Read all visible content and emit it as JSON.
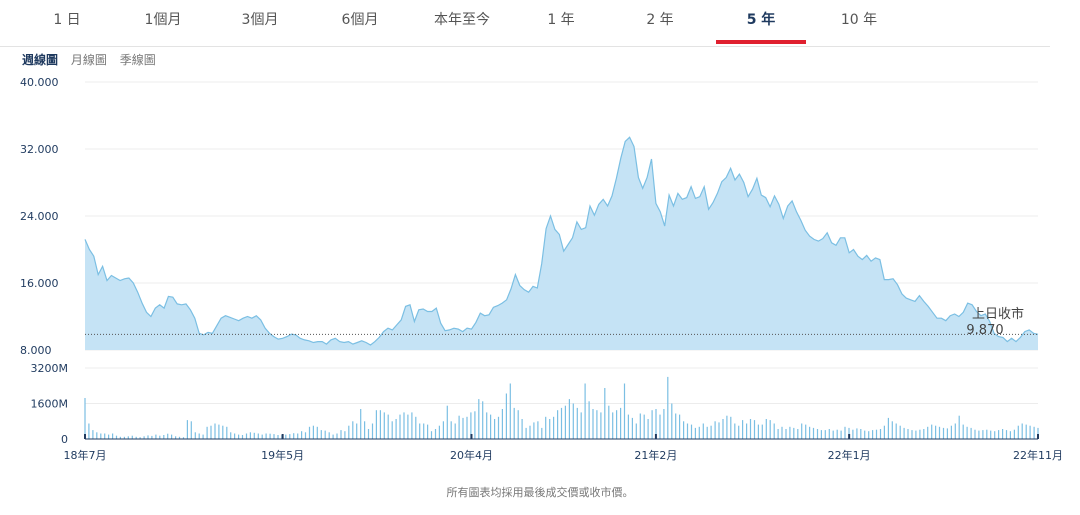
{
  "tabs": [
    {
      "label": "1 日",
      "active": false
    },
    {
      "label": "1個月",
      "active": false
    },
    {
      "label": "3個月",
      "active": false
    },
    {
      "label": "6個月",
      "active": false
    },
    {
      "label": "本年至今",
      "active": false
    },
    {
      "label": "1 年",
      "active": false
    },
    {
      "label": "2 年",
      "active": false
    },
    {
      "label": "5 年",
      "active": true
    },
    {
      "label": "10 年",
      "active": false
    }
  ],
  "views": [
    {
      "label": "週線圖",
      "active": true
    },
    {
      "label": "月線圖",
      "active": false
    },
    {
      "label": "季線圖",
      "active": false
    }
  ],
  "footnote": "所有圖表均採用最後成交價或收市價。",
  "colors": {
    "accent_underline": "#e0202f",
    "area_fill": "#c5e3f5",
    "line": "#7bbfe3",
    "volume_bar": "#7bbfe3",
    "axis_text": "#1f3a5f"
  },
  "chart_data": [
    {
      "type": "area",
      "y_ticks": [
        "40.000",
        "32.000",
        "24.000",
        "16.000",
        "8.000"
      ],
      "ylim": [
        8,
        40
      ],
      "last_close_label": "上日收市",
      "last_close_value": "9.870",
      "last_close": 9.87,
      "grid": true,
      "x_tick_labels": [
        "18年7月",
        "19年5月",
        "20年4月",
        "21年2月",
        "22年1月",
        "22年11月"
      ],
      "x_tick_index": [
        0,
        45,
        88,
        130,
        174,
        217
      ],
      "values": [
        21.2,
        20.0,
        19.2,
        17.0,
        18.0,
        16.3,
        16.9,
        16.6,
        16.3,
        16.5,
        16.6,
        16.0,
        14.9,
        13.6,
        12.5,
        12.0,
        13.0,
        13.4,
        13.0,
        14.4,
        14.3,
        13.5,
        13.4,
        13.5,
        12.8,
        11.8,
        10.0,
        9.8,
        10.1,
        10.0,
        10.9,
        11.8,
        12.1,
        11.9,
        11.7,
        11.5,
        11.8,
        12.0,
        11.8,
        12.1,
        11.6,
        10.6,
        10.0,
        9.6,
        9.3,
        9.4,
        9.6,
        9.9,
        9.8,
        9.4,
        9.2,
        9.1,
        8.9,
        9.0,
        9.0,
        8.7,
        9.2,
        9.4,
        9.0,
        8.9,
        9.0,
        8.7,
        8.9,
        9.1,
        8.9,
        8.6,
        9.0,
        9.5,
        10.2,
        10.6,
        10.4,
        11.0,
        11.6,
        13.2,
        13.4,
        11.4,
        12.8,
        12.9,
        12.6,
        12.6,
        13.0,
        11.2,
        10.3,
        10.4,
        10.6,
        10.5,
        10.2,
        10.6,
        10.5,
        11.3,
        12.4,
        12.1,
        12.2,
        13.1,
        13.3,
        13.6,
        14.0,
        15.3,
        17.0,
        15.7,
        15.2,
        14.9,
        15.6,
        15.4,
        18.3,
        22.5,
        24.0,
        22.4,
        21.8,
        19.8,
        20.6,
        21.4,
        23.3,
        22.4,
        22.6,
        25.2,
        24.1,
        25.4,
        26.0,
        25.2,
        26.4,
        28.5,
        30.9,
        32.9,
        33.4,
        32.3,
        28.6,
        27.3,
        28.6,
        30.8,
        25.5,
        24.5,
        22.8,
        26.5,
        25.2,
        26.7,
        26.0,
        26.2,
        27.5,
        26.1,
        26.3,
        27.5,
        24.8,
        25.6,
        26.7,
        28.1,
        28.6,
        29.7,
        28.3,
        29.0,
        28.0,
        26.3,
        27.2,
        28.5,
        26.5,
        26.2,
        25.1,
        26.4,
        25.4,
        23.7,
        25.2,
        25.8,
        24.5,
        23.5,
        22.3,
        21.6,
        21.2,
        21.0,
        21.3,
        22.0,
        20.8,
        20.5,
        21.4,
        21.4,
        19.6,
        20.0,
        19.2,
        18.8,
        19.3,
        18.6,
        19.0,
        18.8,
        16.4,
        16.4,
        16.5,
        15.8,
        14.7,
        14.2,
        14.0,
        13.8,
        14.5,
        13.8,
        13.2,
        12.5,
        11.8,
        11.8,
        11.5,
        12.1,
        12.3,
        12.0,
        12.5,
        13.6,
        13.4,
        12.6,
        12.1,
        12.3,
        11.4,
        10.0,
        9.6,
        9.5,
        9.0,
        9.4,
        9.0,
        9.5,
        10.2,
        10.4,
        10.0,
        9.87
      ]
    },
    {
      "type": "bar",
      "y_ticks": [
        "3200M",
        "1600M",
        "0"
      ],
      "ylim": [
        0,
        3200
      ],
      "grid": true,
      "values": [
        1850,
        700,
        400,
        300,
        250,
        250,
        200,
        250,
        150,
        100,
        100,
        120,
        150,
        100,
        80,
        120,
        160,
        140,
        200,
        150,
        180,
        240,
        200,
        120,
        100,
        80,
        850,
        800,
        300,
        250,
        200,
        550,
        600,
        700,
        650,
        600,
        550,
        300,
        250,
        200,
        180,
        250,
        300,
        280,
        250,
        200,
        250,
        240,
        220,
        180,
        180,
        200,
        220,
        260,
        250,
        350,
        300,
        550,
        600,
        550,
        400,
        380,
        300,
        200,
        250,
        400,
        350,
        600,
        800,
        700,
        1350,
        800,
        450,
        700,
        1300,
        1300,
        1200,
        1100,
        800,
        900,
        1100,
        1200,
        1100,
        1200,
        1000,
        700,
        700,
        650,
        350,
        450,
        600,
        800,
        1500,
        800,
        700,
        1050,
        950,
        1000,
        1200,
        1250,
        1800,
        1700,
        1200,
        1100,
        900,
        1000,
        1350,
        2050,
        2500,
        1400,
        1300,
        900,
        500,
        600,
        750,
        800,
        500,
        1000,
        900,
        1000,
        1300,
        1400,
        1500,
        1800,
        1600,
        1400,
        1200,
        2500,
        1700,
        1350,
        1300,
        1200,
        2300,
        1500,
        1200,
        1300,
        1400,
        2500,
        1100,
        950,
        700,
        1150,
        1100,
        900,
        1300,
        1350,
        1100,
        1350,
        2800,
        1600,
        1150,
        1100,
        800,
        700,
        650,
        500,
        550,
        700,
        550,
        600,
        800,
        750,
        900,
        1050,
        1000,
        700,
        600,
        850,
        700,
        900,
        850,
        650,
        650,
        900,
        850,
        700,
        450,
        550,
        450,
        550,
        500,
        450,
        700,
        650,
        550,
        500,
        450,
        400,
        400,
        450,
        380,
        420,
        380,
        550,
        500,
        420,
        480,
        450,
        380,
        350,
        400,
        420,
        450,
        600,
        950,
        800,
        700,
        600,
        500,
        450,
        400,
        380,
        420,
        450,
        550,
        650,
        600,
        550,
        500,
        480,
        600,
        700,
        1050,
        650,
        550,
        500,
        420,
        380,
        400,
        420,
        380,
        350,
        400,
        450,
        400,
        350,
        420,
        600,
        700,
        650,
        600,
        550,
        500
      ]
    }
  ]
}
